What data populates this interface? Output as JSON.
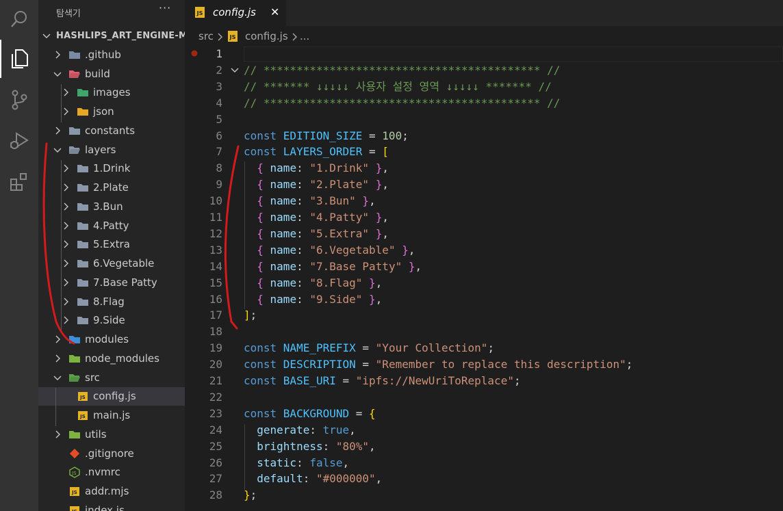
{
  "sidebar": {
    "title": "탐색기",
    "more": "···",
    "tree": [
      {
        "label": "HASHLIPS_ART_ENGINE-M...",
        "icon": "root",
        "chevron": "down",
        "depth": 0
      },
      {
        "label": ".github",
        "icon": "folder-github-icon",
        "chevron": "right",
        "depth": 1
      },
      {
        "label": "build",
        "icon": "folder-build-icon",
        "chevron": "down",
        "depth": 1
      },
      {
        "label": "images",
        "icon": "folder-images-icon",
        "chevron": "right",
        "depth": 2
      },
      {
        "label": "json",
        "icon": "folder-json-icon",
        "chevron": "right",
        "depth": 2
      },
      {
        "label": "constants",
        "icon": "folder-constants-icon",
        "chevron": "right",
        "depth": 1
      },
      {
        "label": "layers",
        "icon": "folder-open-icon",
        "chevron": "down",
        "depth": 1
      },
      {
        "label": "1.Drink",
        "icon": "folder-icon",
        "chevron": "right",
        "depth": 2
      },
      {
        "label": "2.Plate",
        "icon": "folder-icon",
        "chevron": "right",
        "depth": 2
      },
      {
        "label": "3.Bun",
        "icon": "folder-icon",
        "chevron": "right",
        "depth": 2
      },
      {
        "label": "4.Patty",
        "icon": "folder-icon",
        "chevron": "right",
        "depth": 2
      },
      {
        "label": "5.Extra",
        "icon": "folder-icon",
        "chevron": "right",
        "depth": 2
      },
      {
        "label": "6.Vegetable",
        "icon": "folder-icon",
        "chevron": "right",
        "depth": 2
      },
      {
        "label": "7.Base Patty",
        "icon": "folder-icon",
        "chevron": "right",
        "depth": 2
      },
      {
        "label": "8.Flag",
        "icon": "folder-icon",
        "chevron": "right",
        "depth": 2
      },
      {
        "label": "9.Side",
        "icon": "folder-icon",
        "chevron": "right",
        "depth": 2
      },
      {
        "label": "modules",
        "icon": "folder-modules-icon",
        "chevron": "right",
        "depth": 1
      },
      {
        "label": "node_modules",
        "icon": "folder-node-icon",
        "chevron": "right",
        "depth": 1
      },
      {
        "label": "src",
        "icon": "folder-src-icon",
        "chevron": "down",
        "depth": 1
      },
      {
        "label": "config.js",
        "icon": "js-file-icon",
        "chevron": "",
        "depth": 2,
        "selected": true
      },
      {
        "label": "main.js",
        "icon": "js-file-icon",
        "chevron": "",
        "depth": 2
      },
      {
        "label": "utils",
        "icon": "folder-utils-icon",
        "chevron": "right",
        "depth": 1
      },
      {
        "label": ".gitignore",
        "icon": "git-file-icon",
        "chevron": "",
        "depth": 1
      },
      {
        "label": ".nvmrc",
        "icon": "node-file-icon",
        "chevron": "",
        "depth": 1
      },
      {
        "label": "addr.mjs",
        "icon": "js-file-icon",
        "chevron": "",
        "depth": 1
      },
      {
        "label": "index.js",
        "icon": "js-file-icon",
        "chevron": "",
        "depth": 1
      }
    ]
  },
  "tabs": [
    {
      "label": "config.js",
      "badge": "JS",
      "close": "✕"
    }
  ],
  "breadcrumb": {
    "folder": "src",
    "file": "config.js",
    "badge": "JS",
    "tail": "..."
  },
  "editor": {
    "active_line": 1,
    "lines": [
      {
        "n": "1",
        "tokens": []
      },
      {
        "n": "2",
        "fold": true,
        "tokens": [
          {
            "t": "// ****************************************** //",
            "c": "c"
          }
        ]
      },
      {
        "n": "3",
        "tokens": [
          {
            "t": "// ******* ↓↓↓↓↓ 사용자 설정 영역 ↓↓↓↓↓ ******* //",
            "c": "c"
          }
        ]
      },
      {
        "n": "4",
        "tokens": [
          {
            "t": "// ****************************************** //",
            "c": "c"
          }
        ]
      },
      {
        "n": "5",
        "tokens": []
      },
      {
        "n": "6",
        "tokens": [
          {
            "t": "const ",
            "c": "k"
          },
          {
            "t": "EDITION_SIZE",
            "c": "v"
          },
          {
            "t": " = ",
            "c": ""
          },
          {
            "t": "100",
            "c": "n"
          },
          {
            "t": ";",
            "c": ""
          }
        ]
      },
      {
        "n": "7",
        "tokens": [
          {
            "t": "const ",
            "c": "k"
          },
          {
            "t": "LAYERS_ORDER",
            "c": "v"
          },
          {
            "t": " = ",
            "c": ""
          },
          {
            "t": "[",
            "c": "b1"
          }
        ]
      },
      {
        "n": "8",
        "tokens": [
          {
            "t": "  ",
            "c": ""
          },
          {
            "t": "{",
            "c": "b2"
          },
          {
            "t": " name",
            "c": "p"
          },
          {
            "t": ": ",
            "c": ""
          },
          {
            "t": "\"1.Drink\"",
            "c": "s"
          },
          {
            "t": " ",
            "c": ""
          },
          {
            "t": "}",
            "c": "b2"
          },
          {
            "t": ",",
            "c": ""
          }
        ]
      },
      {
        "n": "9",
        "tokens": [
          {
            "t": "  ",
            "c": ""
          },
          {
            "t": "{",
            "c": "b2"
          },
          {
            "t": " name",
            "c": "p"
          },
          {
            "t": ": ",
            "c": ""
          },
          {
            "t": "\"2.Plate\"",
            "c": "s"
          },
          {
            "t": " ",
            "c": ""
          },
          {
            "t": "}",
            "c": "b2"
          },
          {
            "t": ",",
            "c": ""
          }
        ]
      },
      {
        "n": "10",
        "tokens": [
          {
            "t": "  ",
            "c": ""
          },
          {
            "t": "{",
            "c": "b2"
          },
          {
            "t": " name",
            "c": "p"
          },
          {
            "t": ": ",
            "c": ""
          },
          {
            "t": "\"3.Bun\"",
            "c": "s"
          },
          {
            "t": " ",
            "c": ""
          },
          {
            "t": "}",
            "c": "b2"
          },
          {
            "t": ",",
            "c": ""
          }
        ]
      },
      {
        "n": "11",
        "tokens": [
          {
            "t": "  ",
            "c": ""
          },
          {
            "t": "{",
            "c": "b2"
          },
          {
            "t": " name",
            "c": "p"
          },
          {
            "t": ": ",
            "c": ""
          },
          {
            "t": "\"4.Patty\"",
            "c": "s"
          },
          {
            "t": " ",
            "c": ""
          },
          {
            "t": "}",
            "c": "b2"
          },
          {
            "t": ",",
            "c": ""
          }
        ]
      },
      {
        "n": "12",
        "tokens": [
          {
            "t": "  ",
            "c": ""
          },
          {
            "t": "{",
            "c": "b2"
          },
          {
            "t": " name",
            "c": "p"
          },
          {
            "t": ": ",
            "c": ""
          },
          {
            "t": "\"5.Extra\"",
            "c": "s"
          },
          {
            "t": " ",
            "c": ""
          },
          {
            "t": "}",
            "c": "b2"
          },
          {
            "t": ",",
            "c": ""
          }
        ]
      },
      {
        "n": "13",
        "tokens": [
          {
            "t": "  ",
            "c": ""
          },
          {
            "t": "{",
            "c": "b2"
          },
          {
            "t": " name",
            "c": "p"
          },
          {
            "t": ": ",
            "c": ""
          },
          {
            "t": "\"6.Vegetable\"",
            "c": "s"
          },
          {
            "t": " ",
            "c": ""
          },
          {
            "t": "}",
            "c": "b2"
          },
          {
            "t": ",",
            "c": ""
          }
        ]
      },
      {
        "n": "14",
        "tokens": [
          {
            "t": "  ",
            "c": ""
          },
          {
            "t": "{",
            "c": "b2"
          },
          {
            "t": " name",
            "c": "p"
          },
          {
            "t": ": ",
            "c": ""
          },
          {
            "t": "\"7.Base Patty\"",
            "c": "s"
          },
          {
            "t": " ",
            "c": ""
          },
          {
            "t": "}",
            "c": "b2"
          },
          {
            "t": ",",
            "c": ""
          }
        ]
      },
      {
        "n": "15",
        "tokens": [
          {
            "t": "  ",
            "c": ""
          },
          {
            "t": "{",
            "c": "b2"
          },
          {
            "t": " name",
            "c": "p"
          },
          {
            "t": ": ",
            "c": ""
          },
          {
            "t": "\"8.Flag\"",
            "c": "s"
          },
          {
            "t": " ",
            "c": ""
          },
          {
            "t": "}",
            "c": "b2"
          },
          {
            "t": ",",
            "c": ""
          }
        ]
      },
      {
        "n": "16",
        "tokens": [
          {
            "t": "  ",
            "c": ""
          },
          {
            "t": "{",
            "c": "b2"
          },
          {
            "t": " name",
            "c": "p"
          },
          {
            "t": ": ",
            "c": ""
          },
          {
            "t": "\"9.Side\"",
            "c": "s"
          },
          {
            "t": " ",
            "c": ""
          },
          {
            "t": "}",
            "c": "b2"
          },
          {
            "t": ",",
            "c": ""
          }
        ]
      },
      {
        "n": "17",
        "tokens": [
          {
            "t": "]",
            "c": "b1"
          },
          {
            "t": ";",
            "c": ""
          }
        ]
      },
      {
        "n": "18",
        "tokens": []
      },
      {
        "n": "19",
        "tokens": [
          {
            "t": "const ",
            "c": "k"
          },
          {
            "t": "NAME_PREFIX",
            "c": "v"
          },
          {
            "t": " = ",
            "c": ""
          },
          {
            "t": "\"Your Collection\"",
            "c": "s"
          },
          {
            "t": ";",
            "c": ""
          }
        ]
      },
      {
        "n": "20",
        "tokens": [
          {
            "t": "const ",
            "c": "k"
          },
          {
            "t": "DESCRIPTION",
            "c": "v"
          },
          {
            "t": " = ",
            "c": ""
          },
          {
            "t": "\"Remember to replace this description\"",
            "c": "s"
          },
          {
            "t": ";",
            "c": ""
          }
        ]
      },
      {
        "n": "21",
        "tokens": [
          {
            "t": "const ",
            "c": "k"
          },
          {
            "t": "BASE_URI",
            "c": "v"
          },
          {
            "t": " = ",
            "c": ""
          },
          {
            "t": "\"ipfs://NewUriToReplace\"",
            "c": "s"
          },
          {
            "t": ";",
            "c": ""
          }
        ]
      },
      {
        "n": "22",
        "tokens": []
      },
      {
        "n": "23",
        "tokens": [
          {
            "t": "const ",
            "c": "k"
          },
          {
            "t": "BACKGROUND",
            "c": "v"
          },
          {
            "t": " = ",
            "c": ""
          },
          {
            "t": "{",
            "c": "b1"
          }
        ]
      },
      {
        "n": "24",
        "tokens": [
          {
            "t": "  generate",
            "c": "p"
          },
          {
            "t": ": ",
            "c": ""
          },
          {
            "t": "true",
            "c": "k"
          },
          {
            "t": ",",
            "c": ""
          }
        ]
      },
      {
        "n": "25",
        "tokens": [
          {
            "t": "  brightness",
            "c": "p"
          },
          {
            "t": ": ",
            "c": ""
          },
          {
            "t": "\"80%\"",
            "c": "s"
          },
          {
            "t": ",",
            "c": ""
          }
        ]
      },
      {
        "n": "26",
        "tokens": [
          {
            "t": "  static",
            "c": "p"
          },
          {
            "t": ": ",
            "c": ""
          },
          {
            "t": "false",
            "c": "k"
          },
          {
            "t": ",",
            "c": ""
          }
        ]
      },
      {
        "n": "27",
        "tokens": [
          {
            "t": "  default",
            "c": "p"
          },
          {
            "t": ": ",
            "c": ""
          },
          {
            "t": "\"#000000\"",
            "c": "s"
          },
          {
            "t": ",",
            "c": ""
          }
        ]
      },
      {
        "n": "28",
        "tokens": [
          {
            "t": "}",
            "c": "b1"
          },
          {
            "t": ";",
            "c": ""
          }
        ]
      }
    ]
  },
  "colors": {
    "accent": "#e6b422",
    "annotation": "#d41b1b",
    "breakpoint": "#a1260d"
  }
}
